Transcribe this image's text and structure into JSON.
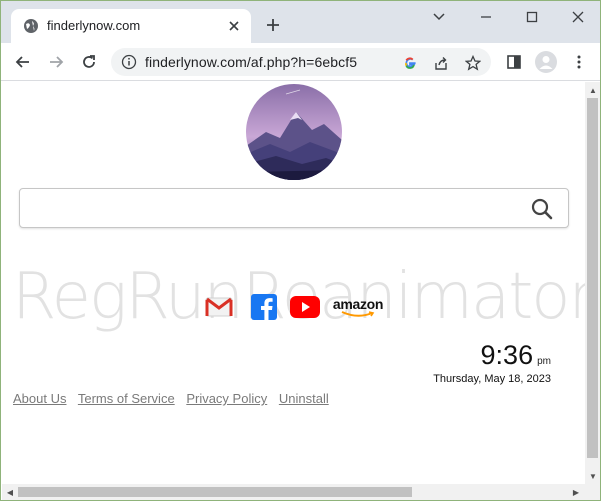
{
  "browser": {
    "tab_title": "finderlynow.com",
    "url": "finderlynow.com/af.php?h=6ebcf5"
  },
  "page": {
    "watermark": "RegRunReanimator.com",
    "search_placeholder": "",
    "shortcuts": [
      {
        "name": "gmail",
        "icon": "gmail-icon"
      },
      {
        "name": "facebook",
        "icon": "facebook-icon"
      },
      {
        "name": "youtube",
        "icon": "youtube-icon"
      },
      {
        "name": "amazon",
        "label": "amazon"
      }
    ],
    "clock": {
      "time": "9:36",
      "ampm": "pm",
      "date": "Thursday, May 18, 2023"
    },
    "footer_links": [
      "About Us",
      "Terms of Service",
      "Privacy Policy",
      "Uninstall"
    ]
  },
  "colors": {
    "titlebar": "#dee3ea",
    "link": "#7a7a7a",
    "logo_sky": "#9a7fb8",
    "facebook": "#1877f2",
    "youtube": "#ff0000"
  }
}
